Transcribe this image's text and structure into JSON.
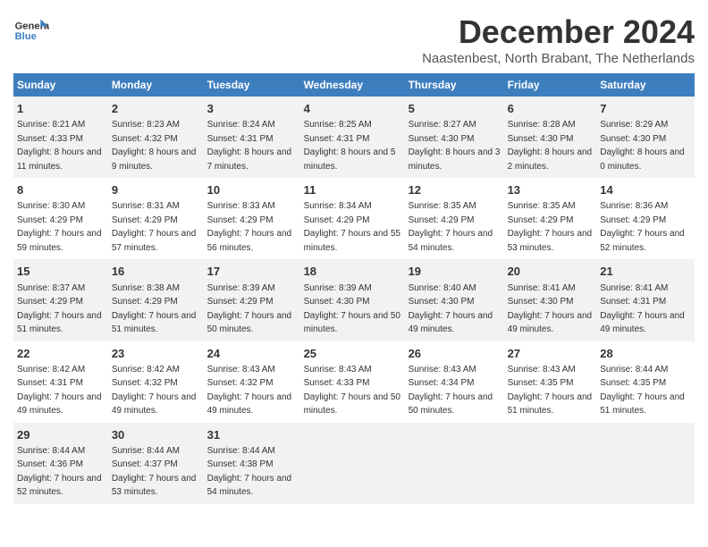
{
  "logo": {
    "line1": "General",
    "line2": "Blue"
  },
  "title": "December 2024",
  "subtitle": "Naastenbest, North Brabant, The Netherlands",
  "days_of_week": [
    "Sunday",
    "Monday",
    "Tuesday",
    "Wednesday",
    "Thursday",
    "Friday",
    "Saturday"
  ],
  "weeks": [
    [
      {
        "day": "1",
        "sunrise": "8:21 AM",
        "sunset": "4:33 PM",
        "daylight": "8 hours and 11 minutes."
      },
      {
        "day": "2",
        "sunrise": "8:23 AM",
        "sunset": "4:32 PM",
        "daylight": "8 hours and 9 minutes."
      },
      {
        "day": "3",
        "sunrise": "8:24 AM",
        "sunset": "4:31 PM",
        "daylight": "8 hours and 7 minutes."
      },
      {
        "day": "4",
        "sunrise": "8:25 AM",
        "sunset": "4:31 PM",
        "daylight": "8 hours and 5 minutes."
      },
      {
        "day": "5",
        "sunrise": "8:27 AM",
        "sunset": "4:30 PM",
        "daylight": "8 hours and 3 minutes."
      },
      {
        "day": "6",
        "sunrise": "8:28 AM",
        "sunset": "4:30 PM",
        "daylight": "8 hours and 2 minutes."
      },
      {
        "day": "7",
        "sunrise": "8:29 AM",
        "sunset": "4:30 PM",
        "daylight": "8 hours and 0 minutes."
      }
    ],
    [
      {
        "day": "8",
        "sunrise": "8:30 AM",
        "sunset": "4:29 PM",
        "daylight": "7 hours and 59 minutes."
      },
      {
        "day": "9",
        "sunrise": "8:31 AM",
        "sunset": "4:29 PM",
        "daylight": "7 hours and 57 minutes."
      },
      {
        "day": "10",
        "sunrise": "8:33 AM",
        "sunset": "4:29 PM",
        "daylight": "7 hours and 56 minutes."
      },
      {
        "day": "11",
        "sunrise": "8:34 AM",
        "sunset": "4:29 PM",
        "daylight": "7 hours and 55 minutes."
      },
      {
        "day": "12",
        "sunrise": "8:35 AM",
        "sunset": "4:29 PM",
        "daylight": "7 hours and 54 minutes."
      },
      {
        "day": "13",
        "sunrise": "8:35 AM",
        "sunset": "4:29 PM",
        "daylight": "7 hours and 53 minutes."
      },
      {
        "day": "14",
        "sunrise": "8:36 AM",
        "sunset": "4:29 PM",
        "daylight": "7 hours and 52 minutes."
      }
    ],
    [
      {
        "day": "15",
        "sunrise": "8:37 AM",
        "sunset": "4:29 PM",
        "daylight": "7 hours and 51 minutes."
      },
      {
        "day": "16",
        "sunrise": "8:38 AM",
        "sunset": "4:29 PM",
        "daylight": "7 hours and 51 minutes."
      },
      {
        "day": "17",
        "sunrise": "8:39 AM",
        "sunset": "4:29 PM",
        "daylight": "7 hours and 50 minutes."
      },
      {
        "day": "18",
        "sunrise": "8:39 AM",
        "sunset": "4:30 PM",
        "daylight": "7 hours and 50 minutes."
      },
      {
        "day": "19",
        "sunrise": "8:40 AM",
        "sunset": "4:30 PM",
        "daylight": "7 hours and 49 minutes."
      },
      {
        "day": "20",
        "sunrise": "8:41 AM",
        "sunset": "4:30 PM",
        "daylight": "7 hours and 49 minutes."
      },
      {
        "day": "21",
        "sunrise": "8:41 AM",
        "sunset": "4:31 PM",
        "daylight": "7 hours and 49 minutes."
      }
    ],
    [
      {
        "day": "22",
        "sunrise": "8:42 AM",
        "sunset": "4:31 PM",
        "daylight": "7 hours and 49 minutes."
      },
      {
        "day": "23",
        "sunrise": "8:42 AM",
        "sunset": "4:32 PM",
        "daylight": "7 hours and 49 minutes."
      },
      {
        "day": "24",
        "sunrise": "8:43 AM",
        "sunset": "4:32 PM",
        "daylight": "7 hours and 49 minutes."
      },
      {
        "day": "25",
        "sunrise": "8:43 AM",
        "sunset": "4:33 PM",
        "daylight": "7 hours and 50 minutes."
      },
      {
        "day": "26",
        "sunrise": "8:43 AM",
        "sunset": "4:34 PM",
        "daylight": "7 hours and 50 minutes."
      },
      {
        "day": "27",
        "sunrise": "8:43 AM",
        "sunset": "4:35 PM",
        "daylight": "7 hours and 51 minutes."
      },
      {
        "day": "28",
        "sunrise": "8:44 AM",
        "sunset": "4:35 PM",
        "daylight": "7 hours and 51 minutes."
      }
    ],
    [
      {
        "day": "29",
        "sunrise": "8:44 AM",
        "sunset": "4:36 PM",
        "daylight": "7 hours and 52 minutes."
      },
      {
        "day": "30",
        "sunrise": "8:44 AM",
        "sunset": "4:37 PM",
        "daylight": "7 hours and 53 minutes."
      },
      {
        "day": "31",
        "sunrise": "8:44 AM",
        "sunset": "4:38 PM",
        "daylight": "7 hours and 54 minutes."
      },
      null,
      null,
      null,
      null
    ]
  ]
}
